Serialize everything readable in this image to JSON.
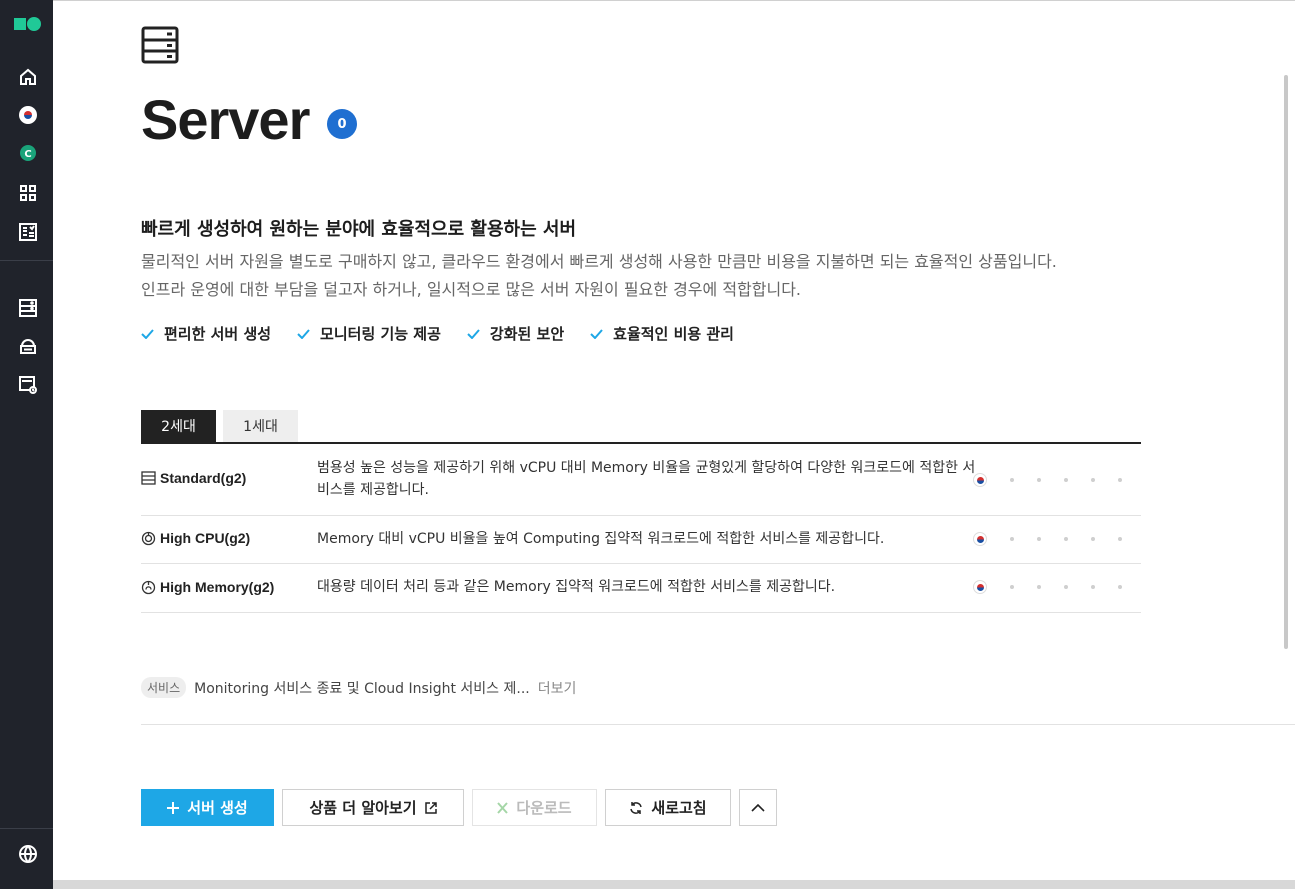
{
  "page": {
    "title": "Server",
    "count": "0",
    "headline": "빠르게 생성하여 원하는 분야에 효율적으로 활용하는 서버",
    "description": [
      "물리적인 서버 자원을 별도로 구매하지 않고, 클라우드 환경에서 빠르게 생성해 사용한 만큼만 비용을 지불하면 되는 효율적인 상품입니다.",
      "인프라 운영에 대한 부담을 덜고자 하거나, 일시적으로 많은 서버 자원이 필요한 경우에 적합합니다."
    ],
    "features": [
      "편리한 서버 생성",
      "모니터링 기능 제공",
      "강화된 보안",
      "효율적인 비용 관리"
    ]
  },
  "tabs": [
    "2세대",
    "1세대"
  ],
  "products": [
    {
      "name": "Standard(g2)",
      "icon": "server-stack-icon",
      "description": "범용성 높은 성능을 제공하기 위해 vCPU 대비 Memory 비율을 균형있게 할당하여 다양한 워크로드에 적합한 서비스를 제공합니다."
    },
    {
      "name": "High CPU(g2)",
      "icon": "cpu-icon",
      "description": "Memory 대비 vCPU 비율을 높여 Computing 집약적 워크로드에 적합한 서비스를 제공합니다."
    },
    {
      "name": "High Memory(g2)",
      "icon": "memory-icon",
      "description": "대용량 데이터 처리 등과 같은 Memory 집약적 워크로드에 적합한 서비스를 제공합니다."
    }
  ],
  "notice": {
    "tag": "서비스",
    "text": "Monitoring 서비스 종료 및 Cloud Insight 서비스 제...",
    "more": "더보기"
  },
  "actions": {
    "create": "서버 생성",
    "learn_more": "상품 더 알아보기",
    "download": "다운로드",
    "refresh": "새로고침"
  },
  "sidebar": {
    "workspace_letter": "C"
  },
  "colors": {
    "brand": "#20c997",
    "primary": "#1ea7e6",
    "badge": "#1f6fd1",
    "sidebar": "#20232b"
  }
}
